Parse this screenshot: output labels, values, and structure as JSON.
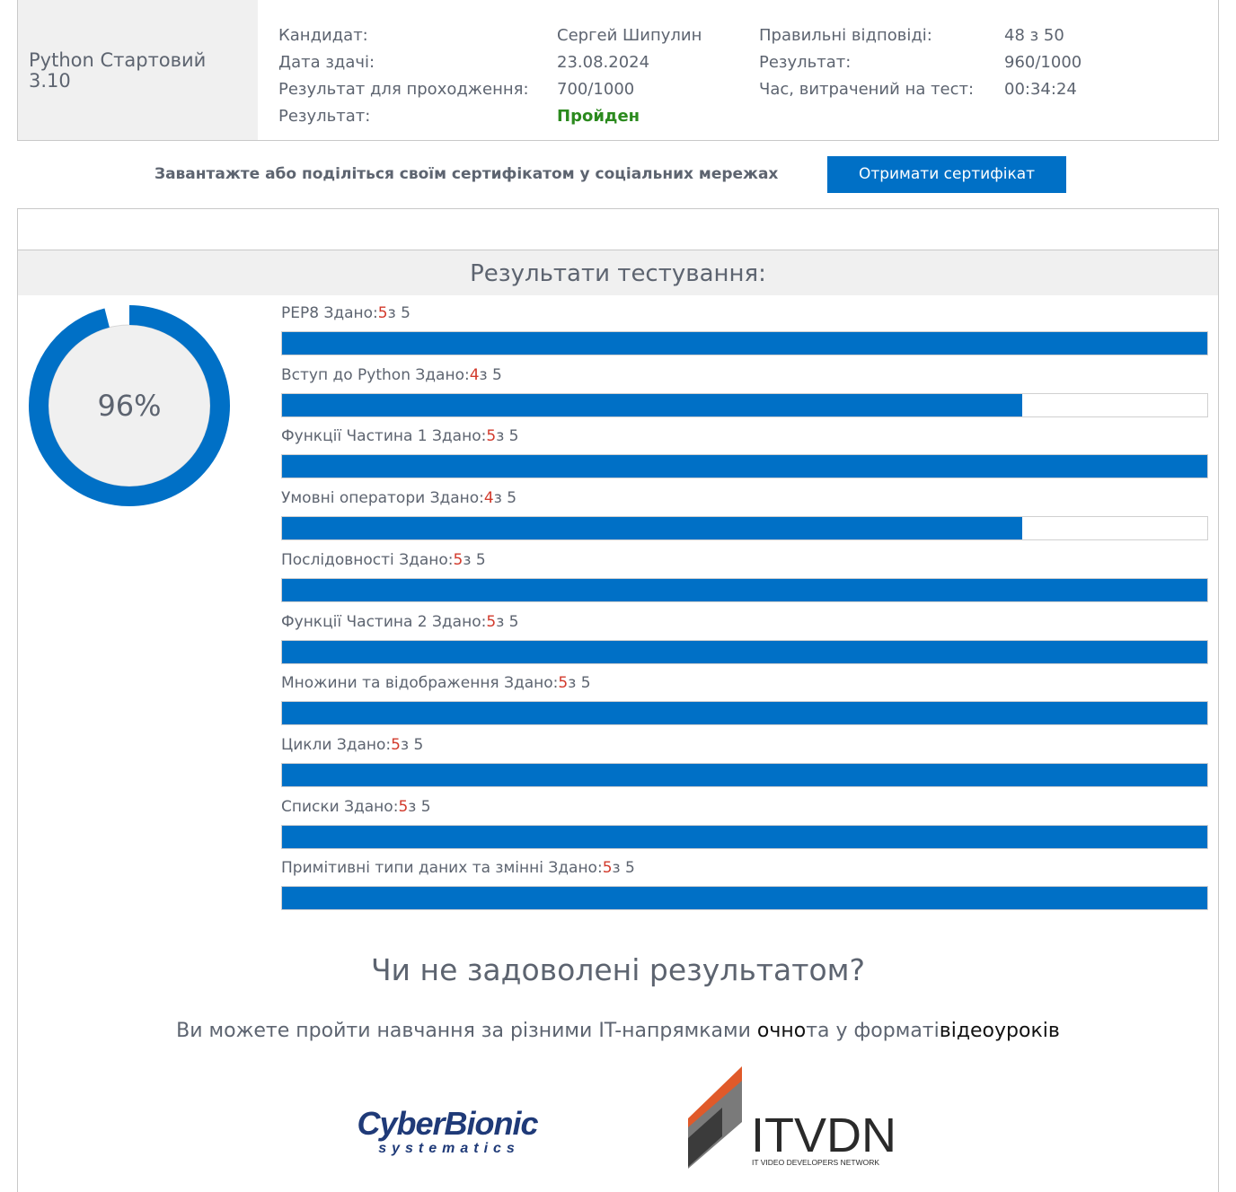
{
  "summary": {
    "course_title": "Python Стартовий 3.10",
    "candidate_label": "Кандидат:",
    "candidate_value": "Сергей Шипулин",
    "date_label": "Дата здачі:",
    "date_value": "23.08.2024",
    "pass_score_label": "Результат для проходження:",
    "pass_score_value": "700/1000",
    "status_label": "Результат:",
    "status_value": "Пройден",
    "correct_label": "Правильні відповіді:",
    "correct_value": "48 з 50",
    "score_label": "Результат:",
    "score_value": "960/1000",
    "time_label": "Час, витрачений на тест:",
    "time_value": "00:34:24"
  },
  "certificate": {
    "prompt": "Завантажте або поділіться своїм сертифікатом у соціальних мережах",
    "button_label": "Отримати сертифікат"
  },
  "results": {
    "heading": "Результати тестування:",
    "overall_percent_label": "96%",
    "overall_percent": 96,
    "passed_word": "Здано:",
    "of_word": "з",
    "sections": [
      {
        "name": "PEP8",
        "passed": "5",
        "total": "5"
      },
      {
        "name": "Вступ до Python",
        "passed": "4",
        "total": "5"
      },
      {
        "name": "Функції Частина 1",
        "passed": "5",
        "total": "5"
      },
      {
        "name": "Умовні оператори",
        "passed": "4",
        "total": "5"
      },
      {
        "name": "Послідовності",
        "passed": "5",
        "total": "5"
      },
      {
        "name": "Функції Частина 2",
        "passed": "5",
        "total": "5"
      },
      {
        "name": "Множини та відображення",
        "passed": "5",
        "total": "5"
      },
      {
        "name": "Цикли",
        "passed": "5",
        "total": "5"
      },
      {
        "name": "Списки",
        "passed": "5",
        "total": "5"
      },
      {
        "name": "Примітивні типи даних та змінні",
        "passed": "5",
        "total": "5"
      }
    ]
  },
  "promo": {
    "heading": "Чи не задоволені результатом?",
    "text_before": "Ви можете пройти навчання за різними IT-напрямками ",
    "link_offline": "очно",
    "text_middle": "та у форматі",
    "link_video": "відеоуроків"
  },
  "logos": {
    "cyberbionic_main": "CyberBionic",
    "cyberbionic_sub": "systematics",
    "itvdn_main": "ITVDN",
    "itvdn_sub": "IT VIDEO DEVELOPERS NETWORK"
  },
  "colors": {
    "accent": "#0070c6",
    "pass": "#2b8a1e",
    "score_red": "#d23a2c",
    "panel_bg": "#f0f0f0"
  }
}
